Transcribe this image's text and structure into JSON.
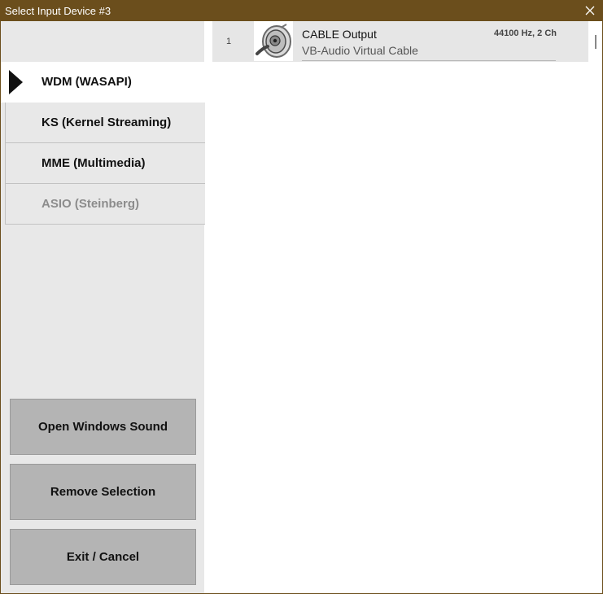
{
  "window": {
    "title": "Select Input Device #3",
    "titlebar_color": "#6b4e1c",
    "close_icon": "close-icon"
  },
  "driver_tabs": [
    {
      "label": "WDM (WASAPI)",
      "active": true,
      "enabled": true
    },
    {
      "label": "KS (Kernel Streaming)",
      "active": false,
      "enabled": true
    },
    {
      "label": "MME (Multimedia)",
      "active": false,
      "enabled": true
    },
    {
      "label": "ASIO (Steinberg)",
      "active": false,
      "enabled": false
    }
  ],
  "actions": {
    "open_sound": "Open Windows Sound",
    "remove_selection": "Remove Selection",
    "exit_cancel": "Exit / Cancel"
  },
  "devices": [
    {
      "index": "1",
      "name": "CABLE Output",
      "driver": "VB-Audio Virtual Cable",
      "format": "44100 Hz, 2 Ch",
      "icon": "audio-cable-icon"
    }
  ]
}
